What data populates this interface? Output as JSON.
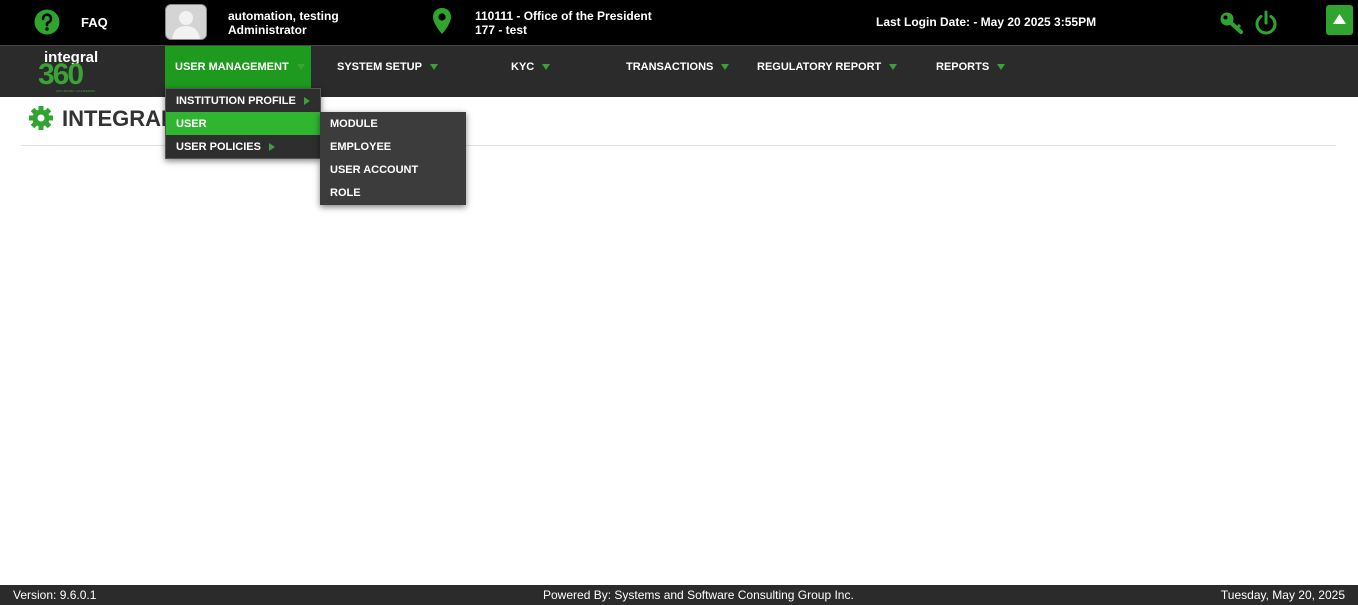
{
  "topbar": {
    "faq_label": "FAQ",
    "user_name": "automation, testing",
    "user_role": "Administrator",
    "location_line1": "110111 - Office of the President",
    "location_line2": "177 - test",
    "last_login": "Last Login Date: - May 20 2025 3:55PM"
  },
  "logo": {
    "line1": "integral",
    "line2": "360",
    "tagline": "ANTI-MONEY LAUNDERING"
  },
  "nav": {
    "items": [
      {
        "label": "USER MANAGEMENT"
      },
      {
        "label": "SYSTEM SETUP"
      },
      {
        "label": "KYC"
      },
      {
        "label": "TRANSACTIONS"
      },
      {
        "label": "REGULATORY REPORT"
      },
      {
        "label": "REPORTS"
      }
    ]
  },
  "dropdown": {
    "items": [
      {
        "label": "INSTITUTION PROFILE"
      },
      {
        "label": "USER"
      },
      {
        "label": "USER POLICIES"
      }
    ]
  },
  "submenu": {
    "items": [
      {
        "label": "MODULE"
      },
      {
        "label": "EMPLOYEE"
      },
      {
        "label": "USER ACCOUNT"
      },
      {
        "label": "ROLE"
      }
    ]
  },
  "page": {
    "title": "INTEGRAL",
    "title_partial": "0"
  },
  "footer": {
    "version": "Version: 9.6.0.1",
    "powered_by": "Powered By: Systems and Software Consulting Group Inc.",
    "date": "Tuesday, May 20, 2025"
  },
  "colors": {
    "accent": "#1e9a1e",
    "topbar": "#000000",
    "navbar": "#2b2b2b",
    "icon_green": "#2fa52f"
  },
  "icons": [
    "help-icon",
    "avatar",
    "location-pin-icon",
    "key-icon",
    "power-icon",
    "scroll-top-icon",
    "gear-icon"
  ]
}
